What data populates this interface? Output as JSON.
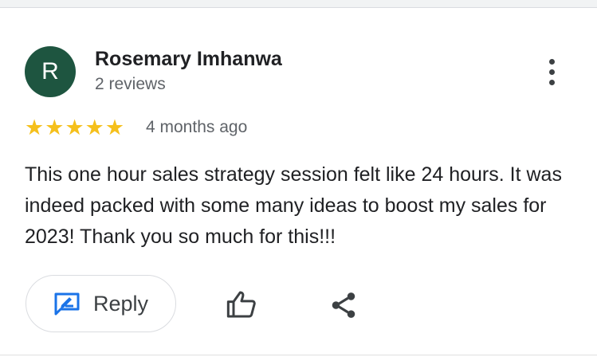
{
  "review": {
    "avatar_initial": "R",
    "avatar_color": "#1e5540",
    "reviewer_name": "Rosemary Imhanwa",
    "review_count": "2 reviews",
    "rating": 5,
    "rating_max": 5,
    "star_color": "#f5c01c",
    "timestamp": "4 months ago",
    "text": "This one hour sales strategy session felt like 24 hours. It was indeed packed with some many ideas to boost my sales for 2023! Thank you so much for this!!!"
  },
  "actions": {
    "reply_label": "Reply",
    "reply_icon": "reply-edit-icon",
    "like_icon": "thumb-up-icon",
    "share_icon": "share-icon",
    "more_icon": "more-vert-icon"
  },
  "colors": {
    "accent": "#1a73e8",
    "text_primary": "#202124",
    "text_secondary": "#5f6368"
  }
}
